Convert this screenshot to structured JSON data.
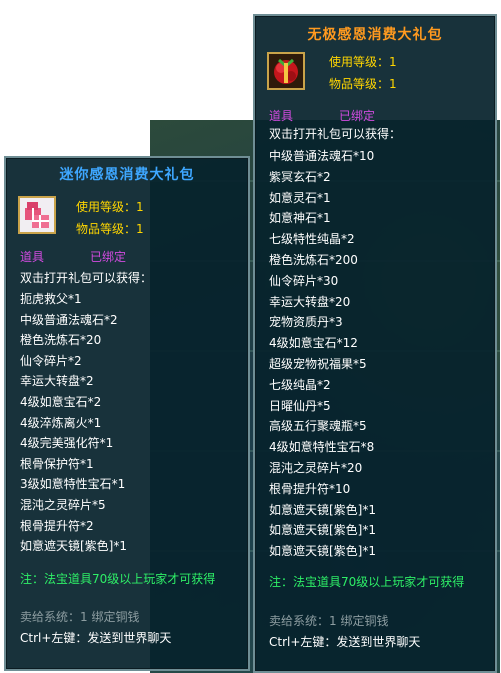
{
  "left_tooltip": {
    "title": "迷你感恩消费大礼包",
    "use_level": "使用等级：1",
    "item_level": "物品等级：1",
    "item_type": "道具",
    "bound": "已绑定",
    "intro": "双击打开礼包可以获得：",
    "items": [
      "扼虎救父*1",
      "中级普通法魂石*2",
      "橙色洗炼石*20",
      "仙令碎片*2",
      "幸运大转盘*2",
      "4级如意宝石*2",
      "4级淬炼离火*1",
      "4级完美强化符*1",
      "根骨保护符*1",
      "3级如意特性宝石*1",
      "混沌之灵碎片*5",
      "根骨提升符*2",
      "如意遮天镜[紫色]*1"
    ],
    "note": "注：法宝道具70级以上玩家才可获得",
    "sell": "卖给系统：1 绑定铜钱",
    "ctrl_hint": "Ctrl+左键：发送到世界聊天"
  },
  "right_tooltip": {
    "title": "无极感恩消费大礼包",
    "use_level": "使用等级：1",
    "item_level": "物品等级：1",
    "item_type": "道具",
    "bound": "已绑定",
    "intro": "双击打开礼包可以获得：",
    "items": [
      "中级普通法魂石*10",
      "紫冥玄石*2",
      "如意灵石*1",
      "如意神石*1",
      "七级特性纯晶*2",
      "橙色洗炼石*200",
      "仙令碎片*30",
      "幸运大转盘*20",
      "宠物资质丹*3",
      "4级如意宝石*12",
      "超级宠物祝福果*5",
      "七级纯晶*2",
      "日曜仙丹*5",
      "高级五行聚魂瓶*5",
      "4级如意特性宝石*8",
      "混沌之灵碎片*20",
      "根骨提升符*10",
      "如意遮天镜[紫色]*1",
      "如意遮天镜[紫色]*1",
      "如意遮天镜[紫色]*1"
    ],
    "note": "注：法宝道具70级以上玩家才可获得",
    "sell": "卖给系统：1 绑定铜钱",
    "ctrl_hint": "Ctrl+左键：发送到世界聊天"
  },
  "colors": {
    "left_title": "#3ea7ff",
    "right_title": "#ff9a1f",
    "level_text": "#ffd600",
    "type_text": "#d24be0",
    "note_text": "#2eef67",
    "sell_text": "#8d9da1"
  },
  "icons": {
    "left_item": "pink-gift-box-icon",
    "right_item": "red-gift-bundle-icon"
  }
}
